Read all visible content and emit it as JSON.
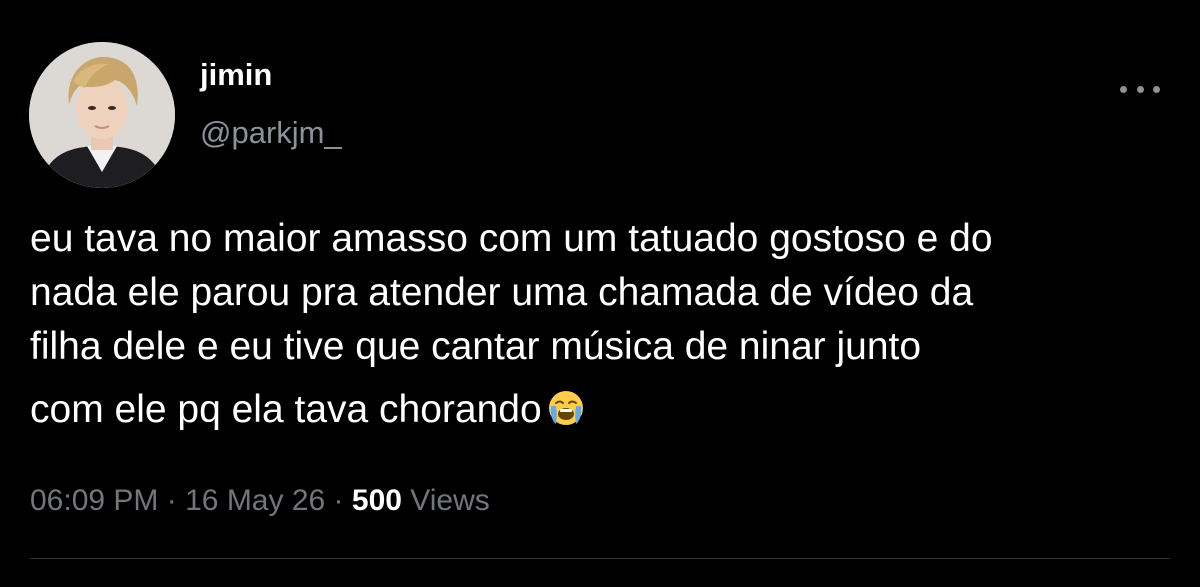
{
  "author": {
    "display_name": "jimin",
    "handle": "@parkjm_"
  },
  "tweet": {
    "lines": [
      "eu tava no maior amasso com um tatuado gostoso e do",
      "nada ele parou pra atender uma chamada de vídeo da",
      "filha dele e eu tive que cantar música de ninar junto",
      "com ele pq ela tava chorando"
    ],
    "emoji": "loudly-crying-face"
  },
  "meta": {
    "time": "06:09 PM",
    "separator": "·",
    "date": "16 May 26",
    "views_count": "500",
    "views_label": "Views"
  },
  "icons": {
    "more": "more-horizontal-icon"
  },
  "colors": {
    "background": "#000000",
    "primary_text": "#ffffff",
    "secondary_text": "#71767b",
    "divider": "#2f3336"
  }
}
